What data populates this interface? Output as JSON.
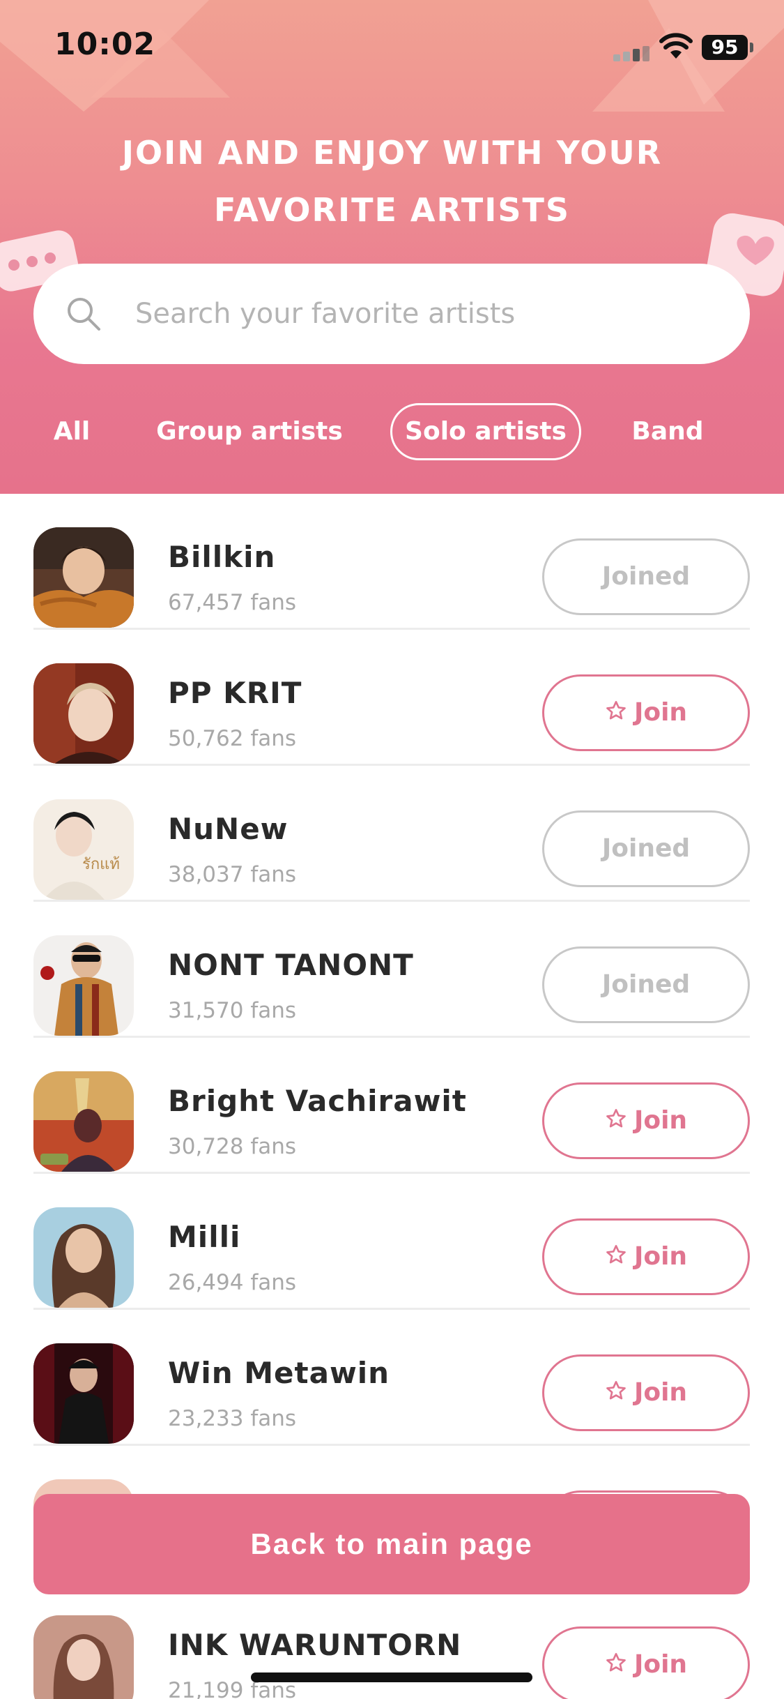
{
  "status_bar": {
    "time": "10:02",
    "battery": "95"
  },
  "header": {
    "title_line1": "JOIN AND ENJOY WITH YOUR",
    "title_line2": "FAVORITE ARTISTS"
  },
  "search": {
    "placeholder": "Search your favorite artists",
    "value": ""
  },
  "tabs": [
    {
      "label": "All",
      "active": false
    },
    {
      "label": "Group artists",
      "active": false
    },
    {
      "label": "Solo artists",
      "active": true
    },
    {
      "label": "Band",
      "active": false
    }
  ],
  "artists": [
    {
      "name": "Billkin",
      "fans": "67,457 fans",
      "status": "joined",
      "button_label": "Joined"
    },
    {
      "name": "PP KRIT",
      "fans": "50,762 fans",
      "status": "join",
      "button_label": "Join"
    },
    {
      "name": "NuNew",
      "fans": "38,037 fans",
      "status": "joined",
      "button_label": "Joined"
    },
    {
      "name": "NONT TANONT",
      "fans": "31,570 fans",
      "status": "joined",
      "button_label": "Joined"
    },
    {
      "name": "Bright Vachirawit",
      "fans": "30,728 fans",
      "status": "join",
      "button_label": "Join"
    },
    {
      "name": "Milli",
      "fans": "26,494 fans",
      "status": "join",
      "button_label": "Join"
    },
    {
      "name": "Win Metawin",
      "fans": "23,233 fans",
      "status": "join",
      "button_label": "Join"
    },
    {
      "name": "",
      "fans": "",
      "status": "join",
      "button_label": ""
    },
    {
      "name": "INK WARUNTORN",
      "fans": "21,199 fans",
      "status": "join",
      "button_label": "Join"
    }
  ],
  "nunew_cover_text": "รักแท้",
  "back_button": {
    "label": "Back to main page"
  },
  "colors": {
    "accent": "#e6718a",
    "header_top": "#f1a193",
    "header_bottom": "#e6728b",
    "joined_border": "#c8c8c8"
  }
}
